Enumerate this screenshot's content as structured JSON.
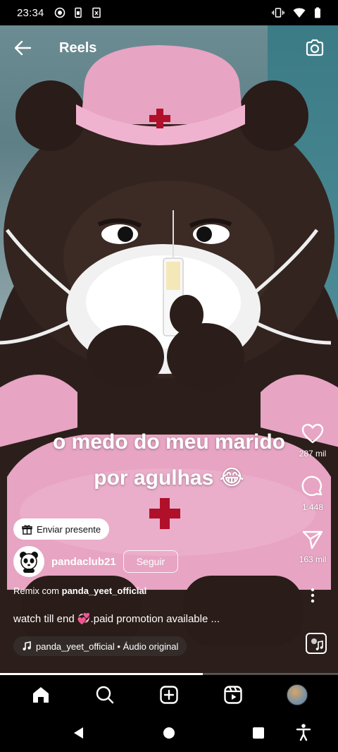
{
  "status_bar": {
    "time": "23:34"
  },
  "header": {
    "title": "Reels"
  },
  "caption": {
    "line1": "o medo do meu marido",
    "line2": "por agulhas 😂"
  },
  "actions": {
    "likes": "287 mil",
    "comments": "1.448",
    "shares": "163 mil"
  },
  "gift": {
    "label": "Enviar presente"
  },
  "author": {
    "username": "pandaclub21",
    "follow_label": "Seguir"
  },
  "remix": {
    "prefix": "Remix com",
    "source": "panda_yeet_official"
  },
  "description": "watch till end 💞.paid promotion available ...",
  "audio": {
    "label": "panda_yeet_official • Áudio original"
  },
  "video": {
    "progress": 0.6
  },
  "colors": {
    "scrubs_pink": "#e7a4c3",
    "bear_brown": "#2c1f1b",
    "accent_red": "#b0102a"
  },
  "icons": [
    "back-arrow-icon",
    "camera-icon",
    "heart-icon",
    "comment-icon",
    "send-icon",
    "more-icon",
    "music-note-icon",
    "gift-icon",
    "home-icon",
    "search-icon",
    "create-icon",
    "reels-icon",
    "profile-icon"
  ]
}
